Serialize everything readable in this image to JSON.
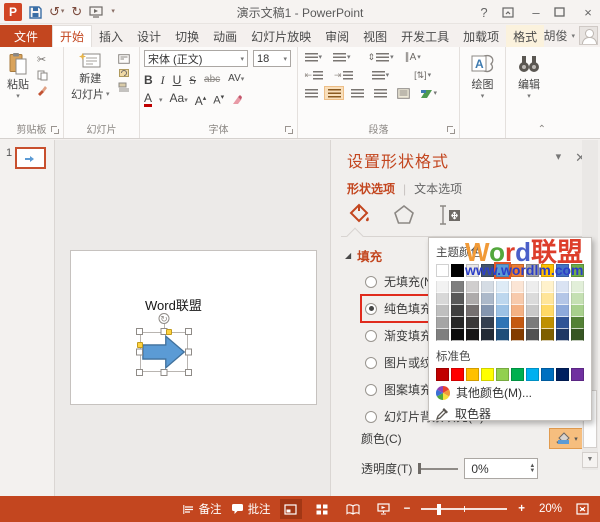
{
  "app": {
    "title": "演示文稿1 - PowerPoint",
    "user": "胡俊"
  },
  "titlebar": {
    "help": "?",
    "minimize": "–",
    "close": "×",
    "undo_glyph": "↺",
    "redo_glyph": "↻",
    "qat_drop": "▾"
  },
  "tabs": {
    "file": "文件",
    "items": [
      {
        "label": "开始",
        "active": true,
        "contextual": false
      },
      {
        "label": "插入",
        "active": false,
        "contextual": false
      },
      {
        "label": "设计",
        "active": false,
        "contextual": false
      },
      {
        "label": "切换",
        "active": false,
        "contextual": false
      },
      {
        "label": "动画",
        "active": false,
        "contextual": false
      },
      {
        "label": "幻灯片放映",
        "active": false,
        "contextual": false
      },
      {
        "label": "审阅",
        "active": false,
        "contextual": false
      },
      {
        "label": "视图",
        "active": false,
        "contextual": false
      },
      {
        "label": "开发工具",
        "active": false,
        "contextual": false
      },
      {
        "label": "加载项",
        "active": false,
        "contextual": false
      },
      {
        "label": "格式",
        "active": false,
        "contextual": true
      }
    ]
  },
  "ribbon": {
    "paste": "粘贴",
    "new_slide_1": "新建",
    "new_slide_2": "幻灯片",
    "font_name": "宋体 (正文)",
    "font_size": "18",
    "bold": "B",
    "italic": "I",
    "underline": "U",
    "strike": "S",
    "clear_small": "abc",
    "spacing": "AV",
    "font_color": "A",
    "case": "Aa",
    "grow": "A",
    "shrink": "A",
    "drawing": "绘图",
    "editing": "编辑",
    "groups": {
      "clipboard": "剪贴板",
      "slides": "幻灯片",
      "font": "字体",
      "paragraph": "段落"
    }
  },
  "thumbnails": {
    "slide_number": "1"
  },
  "slide": {
    "watermark": "Word联盟",
    "shape": {
      "fill": "#5B9BD5",
      "border": "#41719C"
    }
  },
  "pane": {
    "title": "设置形状格式",
    "tab_shape": "形状选项",
    "tab_text": "文本选项",
    "section_fill": "填充",
    "fill_options": [
      {
        "label": "无填充(N)",
        "selected": false,
        "annotated": false
      },
      {
        "label": "纯色填充(S)",
        "selected": true,
        "annotated": true
      },
      {
        "label": "渐变填充(G)",
        "selected": false,
        "annotated": false
      },
      {
        "label": "图片或纹理填充(P)",
        "selected": false,
        "annotated": false
      },
      {
        "label": "图案填充(A)",
        "selected": false,
        "annotated": false
      },
      {
        "label": "幻灯片背景填充(B)",
        "selected": false,
        "annotated": false
      }
    ],
    "color_label": "颜色(C)",
    "transparency_label": "透明度(T)",
    "transparency_value": "0%"
  },
  "picker": {
    "theme_header": "主题颜色",
    "standard_header": "标准色",
    "more_colors": "其他颜色(M)...",
    "eyedropper": "取色器",
    "selected_column": 4,
    "theme": [
      {
        "base": "#FFFFFF",
        "tints": [
          "#F2F2F2",
          "#D8D8D8",
          "#BFBFBF",
          "#A5A5A5",
          "#7F7F7F"
        ]
      },
      {
        "base": "#000000",
        "tints": [
          "#7F7F7F",
          "#595959",
          "#3F3F3F",
          "#262626",
          "#0C0C0C"
        ]
      },
      {
        "base": "#E7E6E6",
        "tints": [
          "#D0CECE",
          "#AEABAB",
          "#757070",
          "#3A3838",
          "#171616"
        ]
      },
      {
        "base": "#44546A",
        "tints": [
          "#D5DCE4",
          "#ACB9CA",
          "#8496B0",
          "#333F50",
          "#222A35"
        ]
      },
      {
        "base": "#5B9BD5",
        "tints": [
          "#DEEBF6",
          "#BDD7EE",
          "#9CC2E5",
          "#2E74B5",
          "#1F4E79"
        ]
      },
      {
        "base": "#ED7D31",
        "tints": [
          "#FBE5D5",
          "#F7CAAC",
          "#F4B183",
          "#C45911",
          "#833C00"
        ]
      },
      {
        "base": "#A5A5A5",
        "tints": [
          "#EDEDED",
          "#DBDBDB",
          "#C9C9C9",
          "#7B7B7B",
          "#525252"
        ]
      },
      {
        "base": "#FFC000",
        "tints": [
          "#FFF2CC",
          "#FFE599",
          "#FFD966",
          "#BF9000",
          "#7F6000"
        ]
      },
      {
        "base": "#4472C4",
        "tints": [
          "#DAE3F3",
          "#B4C6E7",
          "#8EAADB",
          "#2F5496",
          "#1F3864"
        ]
      },
      {
        "base": "#70AD47",
        "tints": [
          "#E2EFD9",
          "#C5E0B3",
          "#A8D08D",
          "#538135",
          "#375623"
        ]
      }
    ],
    "standard": [
      "#C00000",
      "#FF0000",
      "#FFC000",
      "#FFFF00",
      "#92D050",
      "#00B050",
      "#00B0F0",
      "#0070C0",
      "#002060",
      "#7030A0"
    ],
    "watermark": {
      "word_segments": [
        {
          "t": "W",
          "c": "#F19A37"
        },
        {
          "t": "o",
          "c": "#53A73C"
        },
        {
          "t": "r",
          "c": "#DD3E2B"
        },
        {
          "t": "d",
          "c": "#4A5FC9"
        },
        {
          "t": "联盟",
          "c": "#DD3E2B"
        }
      ],
      "site": "www.wordlm.com"
    }
  },
  "statusbar": {
    "notes": "备注",
    "comments": "批注",
    "zoom_value": "20%",
    "zoom_percent": 20
  }
}
